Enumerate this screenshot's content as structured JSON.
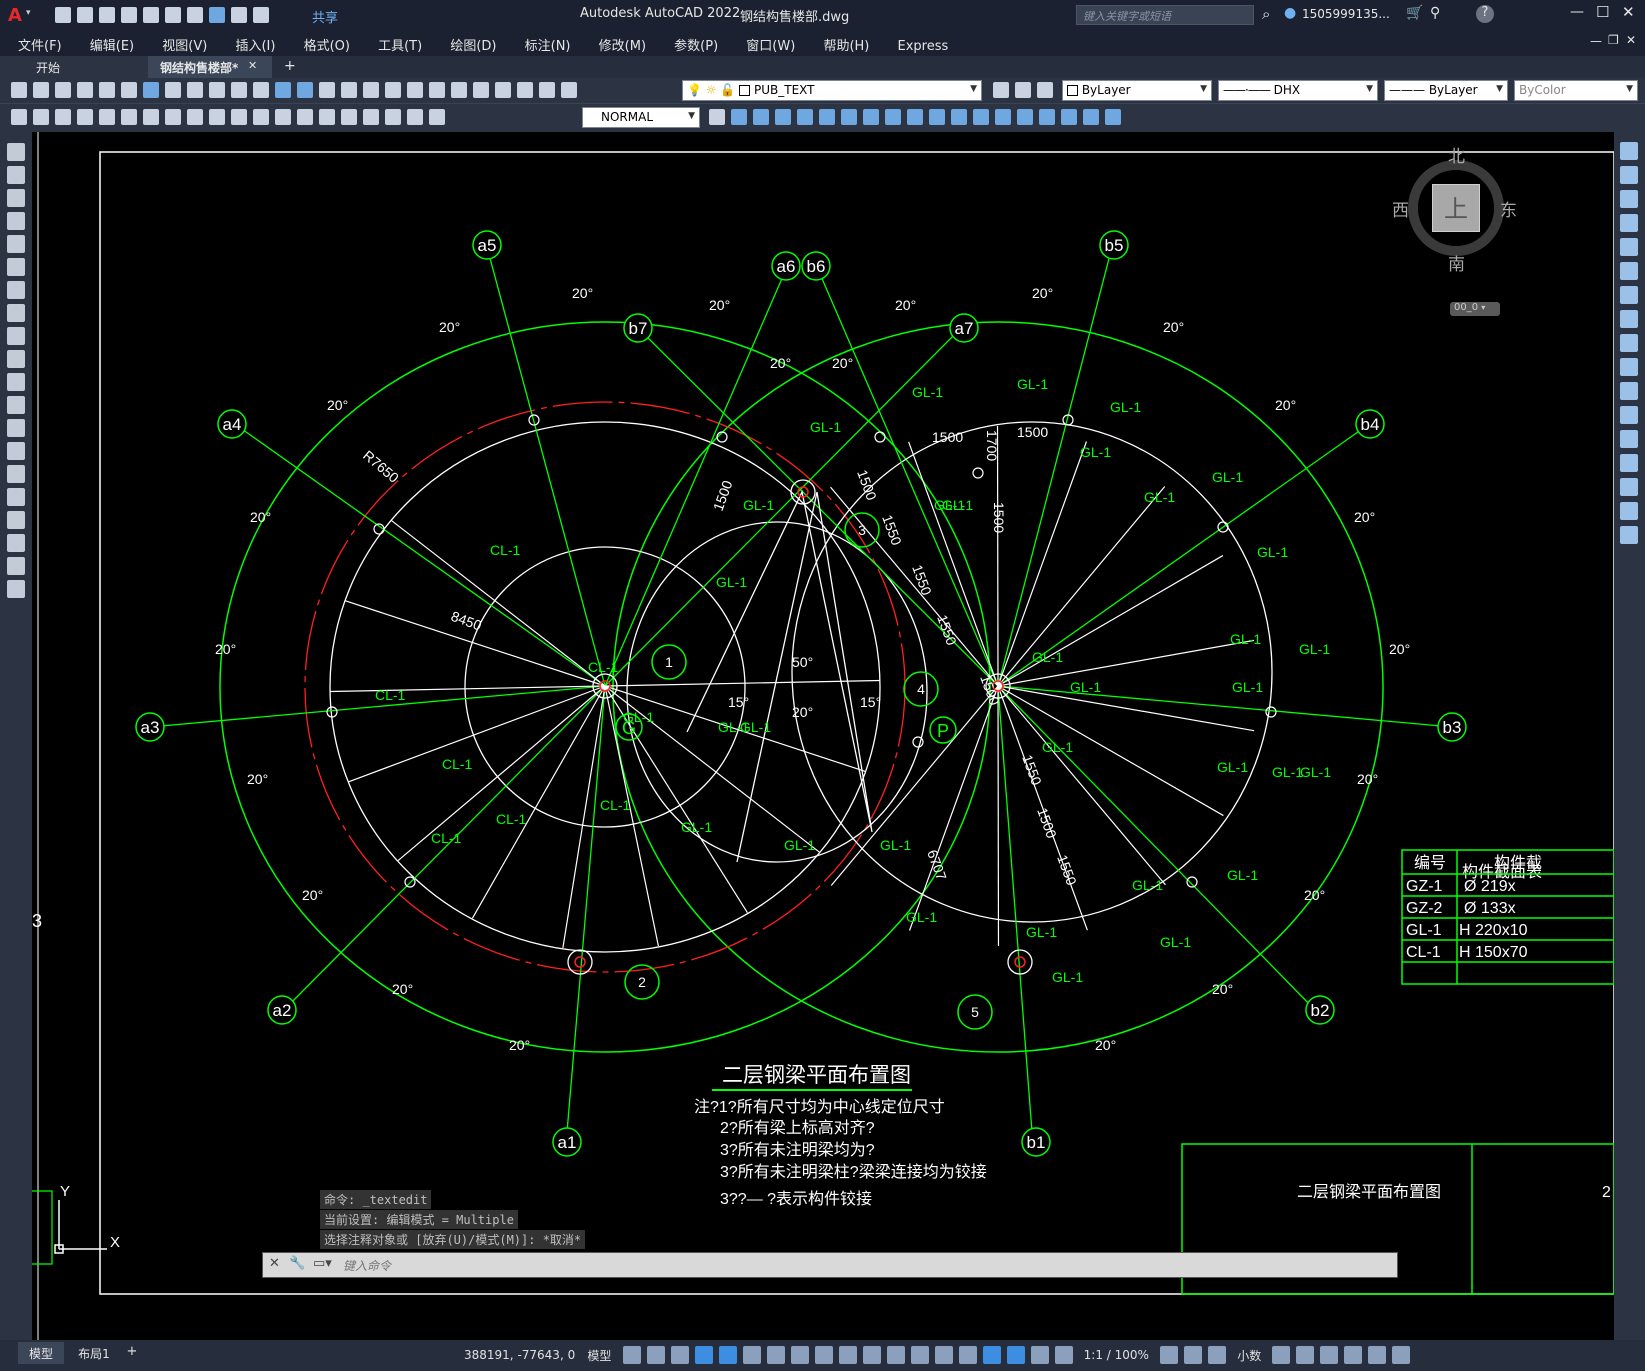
{
  "app": {
    "title": "Autodesk AutoCAD 2022",
    "file": "钢结构售楼部.dwg",
    "share": "共享",
    "search_placeholder": "键入关键字或短语",
    "user": "1505999135...",
    "help": "?"
  },
  "menu": [
    "文件(F)",
    "编辑(E)",
    "视图(V)",
    "插入(I)",
    "格式(O)",
    "工具(T)",
    "绘图(D)",
    "标注(N)",
    "修改(M)",
    "参数(P)",
    "窗口(W)",
    "帮助(H)",
    "Express"
  ],
  "tabs": {
    "start": "开始",
    "doc": "钢结构售楼部*",
    "close": "✕",
    "add": "+"
  },
  "toolbar": {
    "layer": "PUB_TEXT",
    "color": "ByLayer",
    "linetype": "DHX",
    "lineweight": "ByLayer",
    "plotstyle": "ByColor",
    "dimstyle": "NORMAL"
  },
  "viewcube": {
    "north": "北",
    "south": "南",
    "east": "东",
    "west": "西",
    "top": "上",
    "wcs": "00_0"
  },
  "drawing": {
    "title": "二层钢梁平面布置图",
    "notes": [
      "注?1?所有尺寸均为中心线定位尺寸",
      "2?所有梁上标高对齐?",
      "3?所有未注明梁均为?",
      "3?所有未注明梁柱?梁梁连接均为铰接",
      "3??— ?表示构件铰接"
    ],
    "axes_a": [
      "a1",
      "a2",
      "a3",
      "a4",
      "a5",
      "a6",
      "a7"
    ],
    "axes_b": [
      "b1",
      "b2",
      "b3",
      "b4",
      "b5",
      "b6",
      "b7"
    ],
    "beam_label_gl": "GL-1",
    "beam_label_cl": "CL-1",
    "angle_20": "20°",
    "angle_15": "15°",
    "angle_50": "50°",
    "dims": [
      "R7650",
      "8450",
      "1500",
      "1550",
      "1700",
      "6707"
    ],
    "markers": [
      "1",
      "2",
      "3",
      "4",
      "5",
      "G",
      "P"
    ],
    "table": {
      "title": "构件截面表",
      "header": [
        "编号",
        "构件截"
      ],
      "rows": [
        [
          "GZ-1",
          "Ø 219x"
        ],
        [
          "GZ-2",
          "Ø 133x"
        ],
        [
          "GL-1",
          "H 220x10"
        ],
        [
          "CL-1",
          "H 150x70"
        ],
        [
          "",
          ""
        ]
      ]
    },
    "title_block": "二层钢梁平面布置图",
    "title_block_num": "2",
    "side_num": "3"
  },
  "command": {
    "lines": [
      "命令: _textedit",
      "当前设置: 编辑模式 = Multiple",
      "选择注释对象或 [放弃(U)/模式(M)]: *取消*"
    ],
    "placeholder": "键入命令"
  },
  "ucs": {
    "x": "X",
    "y": "Y"
  },
  "layouts": [
    "模型",
    "布局1",
    "+"
  ],
  "status": {
    "coords": "388191, -77643, 0",
    "model": "模型",
    "scale": "1:1 / 100%",
    "units": "小数"
  }
}
